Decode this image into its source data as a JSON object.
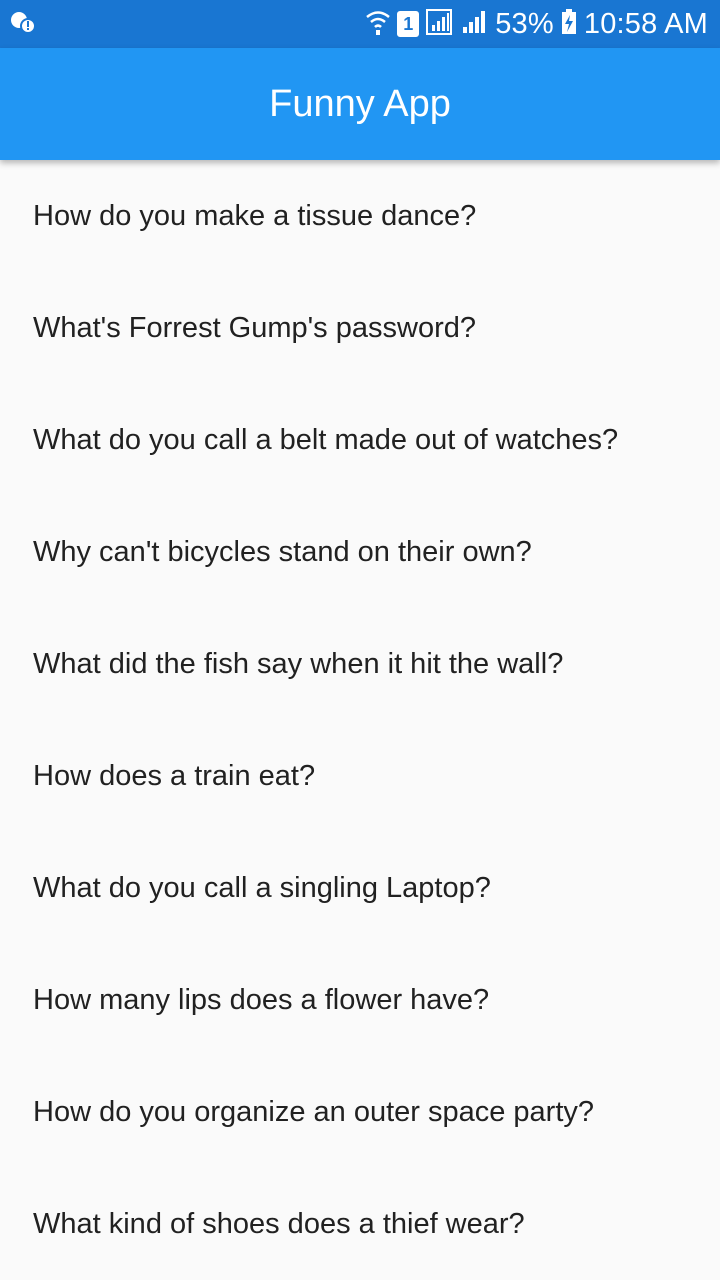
{
  "status_bar": {
    "sim_slot": "1",
    "battery": "53%",
    "time": "10:58 AM",
    "icons": [
      "notification-icon",
      "wifi-icon",
      "sim-icon",
      "signal-icon",
      "signal-icon",
      "battery-charging-icon"
    ]
  },
  "app_bar": {
    "title": "Funny App",
    "color": "#2196f3"
  },
  "jokes": [
    "How do you make a tissue dance?",
    "What's Forrest Gump's password?",
    "What do you call a belt made out of watches?",
    "Why can't bicycles stand on their own?",
    "What did the fish say when it hit the wall?",
    "How does a train eat?",
    "What do you call a singling Laptop?",
    "How many lips does a flower have?",
    "How do you organize an outer space party?",
    "What kind of shoes does a thief wear?"
  ]
}
